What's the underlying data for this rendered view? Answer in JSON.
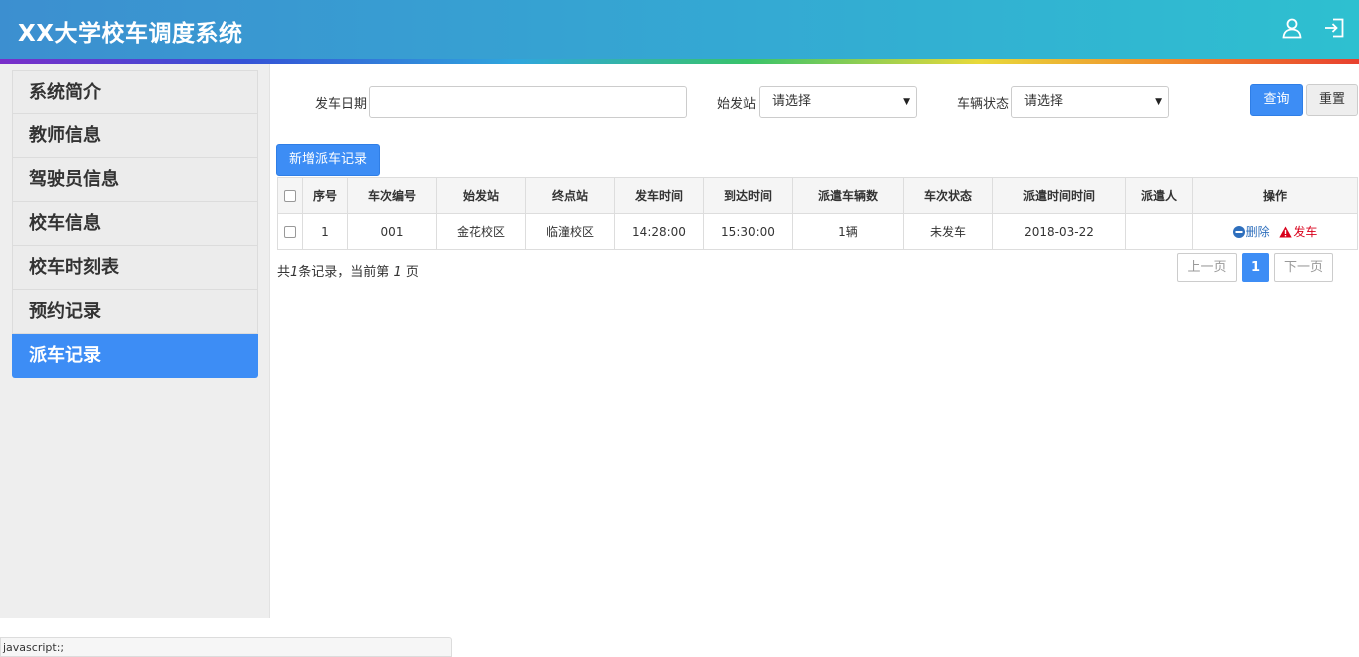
{
  "app": {
    "title": "XX大学校车调度系统"
  },
  "header_icons": {
    "user": "user-icon",
    "logout": "logout-icon"
  },
  "sidebar": {
    "items": [
      {
        "label": "系统简介",
        "active": false
      },
      {
        "label": "教师信息",
        "active": false
      },
      {
        "label": "驾驶员信息",
        "active": false
      },
      {
        "label": "校车信息",
        "active": false
      },
      {
        "label": "校车时刻表",
        "active": false
      },
      {
        "label": "预约记录",
        "active": false
      },
      {
        "label": "派车记录",
        "active": true
      }
    ]
  },
  "filters": {
    "date_label": "发车日期",
    "date_value": "",
    "start_label": "始发站",
    "start_value": "请选择",
    "status_label": "车辆状态",
    "status_value": "请选择",
    "query_label": "查询",
    "reset_label": "重置"
  },
  "toolbar": {
    "add_label": "新增派车记录"
  },
  "table": {
    "columns": [
      "序号",
      "车次编号",
      "始发站",
      "终点站",
      "发车时间",
      "到达时间",
      "派遣车辆数",
      "车次状态",
      "派遣时间时间",
      "派遣人",
      "操作"
    ],
    "rows": [
      {
        "index": "1",
        "trip_no": "001",
        "start": "金花校区",
        "end": "临潼校区",
        "depart": "14:28:00",
        "arrive": "15:30:00",
        "vehicles": "1辆",
        "status": "未发车",
        "dispatch_time": "2018-03-22",
        "dispatcher": "",
        "delete_label": "删除",
        "depart_label": "发车"
      }
    ]
  },
  "pagination": {
    "summary_prefix": "共",
    "total": "1",
    "summary_mid": "条记录，当前第",
    "current": "1",
    "summary_suffix": "页",
    "prev_label": "上一页",
    "page_label": "1",
    "next_label": "下一页"
  },
  "statusbar": {
    "text": "javascript:;"
  },
  "colors": {
    "primary": "#3d8df5",
    "danger": "#d9001b",
    "link": "#2e6fbd"
  }
}
